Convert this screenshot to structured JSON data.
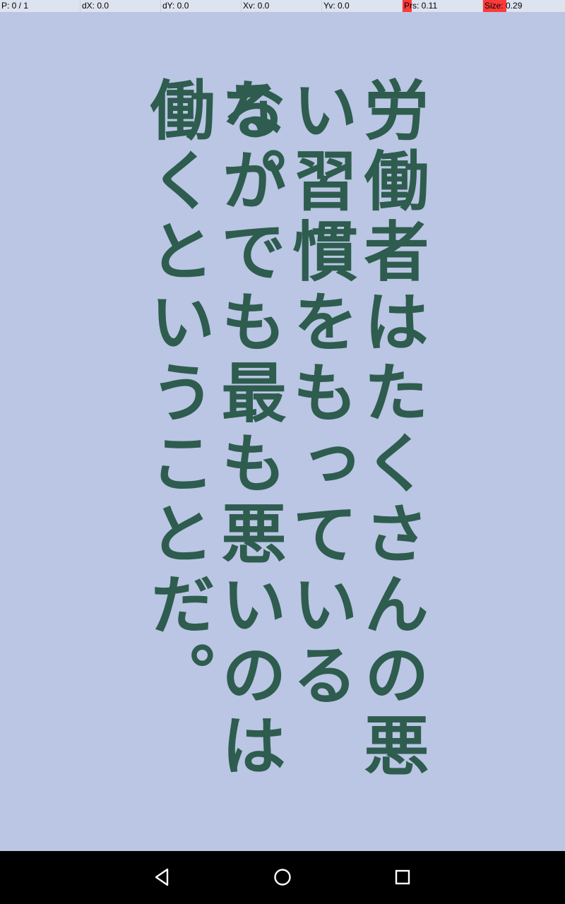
{
  "overlay": {
    "pointer": "P: 0 / 1",
    "dx": "dX: 0.0",
    "dy": "dY: 0.0",
    "xv": "Xv: 0.0",
    "yv": "Yv: 0.0",
    "prs": "Prs: 0.11",
    "size": "Size: 0.29",
    "prs_level": 0.11,
    "size_level": 0.29,
    "highlight_color": "#ff3a3a"
  },
  "text": {
    "columns": [
      "労働者はたくさんの悪",
      "い習慣をもっているる。",
      "なかでも最も悪いのは",
      "働くということだ。"
    ]
  },
  "colors": {
    "background": "#bac6e4",
    "text": "#2e5c4e",
    "navbar": "#000000"
  },
  "navbar": {
    "back_icon": "back-icon",
    "home_icon": "home-icon",
    "recents_icon": "recents-icon"
  }
}
